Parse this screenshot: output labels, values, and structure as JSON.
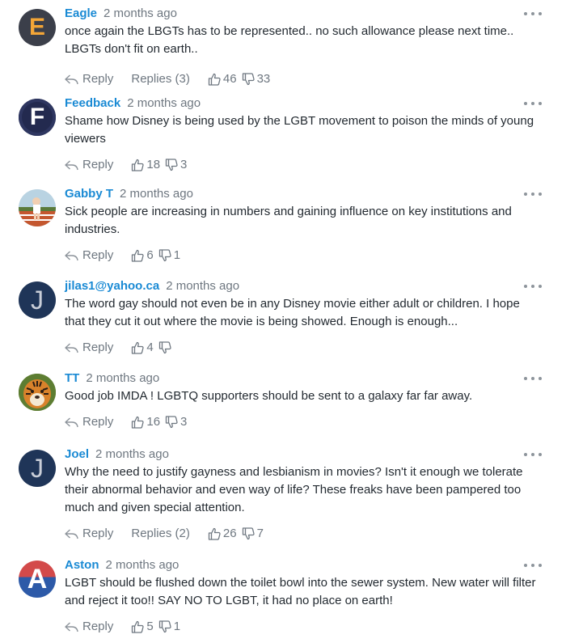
{
  "reply_label": "Reply",
  "comments": [
    {
      "author": "Eagle",
      "time": "2 months ago",
      "text": "once again the LBGTs has to be represented.. no such allowance please next time.. LBGTs don't fit on earth..",
      "replies": "Replies (3)",
      "likes": "46",
      "dislikes": "33",
      "avatar": {
        "letter": "E",
        "bg": "#3b3f4a",
        "fg": "#f4a637"
      }
    },
    {
      "author": "Feedback",
      "time": "2 months ago",
      "text": "Shame how Disney is being used by the LGBT movement to poison the minds of young viewers",
      "replies": "",
      "likes": "18",
      "dislikes": "3",
      "avatar": {
        "letter": "F",
        "bg": "#232a4f",
        "fg": "#ffffff"
      }
    },
    {
      "author": "Gabby T",
      "time": "2 months ago",
      "text": "Sick people are increasing in numbers and gaining influence on key institutions and industries.",
      "replies": "",
      "likes": "6",
      "dislikes": "1",
      "avatar": {
        "letter": "",
        "bg": "#c9d6dc",
        "fg": "#ffffff"
      }
    },
    {
      "author": "jilas1@yahoo.ca",
      "time": "2 months ago",
      "text": "The word gay should not even be in any Disney movie either adult or children. I hope that they cut it out where the movie is being showed. Enough is enough...",
      "replies": "",
      "likes": "4",
      "dislikes": "",
      "avatar": {
        "letter": "J",
        "bg": "#1f3558",
        "fg": "#c9ced8"
      }
    },
    {
      "author": "TT",
      "time": "2 months ago",
      "text": "Good job IMDA ! LGBTQ supporters should be sent to a galaxy far far away.",
      "replies": "",
      "likes": "16",
      "dislikes": "3",
      "avatar": {
        "letter": "",
        "bg": "#6b8a3a",
        "fg": "#ffffff"
      }
    },
    {
      "author": "Joel",
      "time": "2 months ago",
      "text": "Why the need to justify gayness and lesbianism in movies? Isn't it enough we tolerate their abnormal behavior and even way of life? These freaks have been pampered too much and given special attention.",
      "replies": "Replies (2)",
      "likes": "26",
      "dislikes": "7",
      "avatar": {
        "letter": "J",
        "bg": "#1f3558",
        "fg": "#c9ced8"
      }
    },
    {
      "author": "Aston",
      "time": "2 months ago",
      "text": "LGBT should be flushed down the toilet bowl into the sewer system. New water will filter and reject it too!! SAY NO TO LGBT, it had no place on earth!",
      "replies": "",
      "likes": "5",
      "dislikes": "1",
      "avatar": {
        "letter": "A",
        "bg": "#d34a4a",
        "fg": "#ffffff"
      }
    }
  ]
}
